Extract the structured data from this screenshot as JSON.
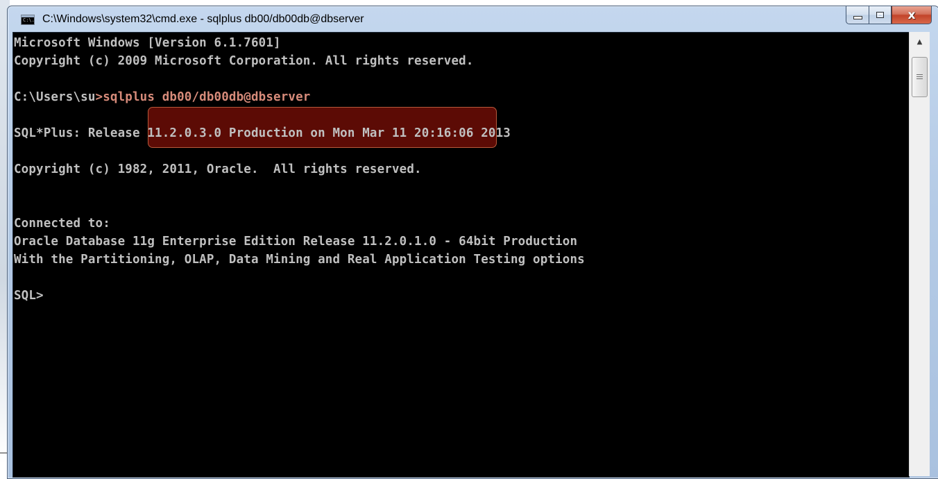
{
  "window": {
    "title": "C:\\Windows\\system32\\cmd.exe - sqlplus  db00/db00db@dbserver",
    "icon": "console-app-icon",
    "icon_text": "C:\\.",
    "buttons": {
      "minimize_icon": "minimize-icon",
      "maximize_icon": "maximize-icon",
      "close_icon": "close-icon",
      "close_glyph": "x"
    }
  },
  "console": {
    "lines": [
      "Microsoft Windows [Version 6.1.7601]",
      "Copyright (c) 2009 Microsoft Corporation. All rights reserved.",
      "",
      "C:\\Users\\su",
      "",
      "SQL*Plus: Release 11.2.0.3.0 Production on Mon Mar 11 20:16:06 2013",
      "",
      "Copyright (c) 1982, 2011, Oracle.  All rights reserved.",
      "",
      "",
      "Connected to:",
      "Oracle Database 11g Enterprise Edition Release 11.2.0.1.0 - 64bit Production",
      "With the Partitioning, OLAP, Data Mining and Real Application Testing options",
      "",
      "SQL>"
    ],
    "highlighted_command": ">sqlplus db00/db00db@dbserver",
    "colors": {
      "background": "#000000",
      "text": "#c0c0c0",
      "highlight_fill": "#5c0b05",
      "highlight_border": "#b85a3c"
    }
  },
  "scrollbar": {
    "up_arrow_icon": "scroll-up-arrow-icon",
    "up_glyph": "▲"
  }
}
